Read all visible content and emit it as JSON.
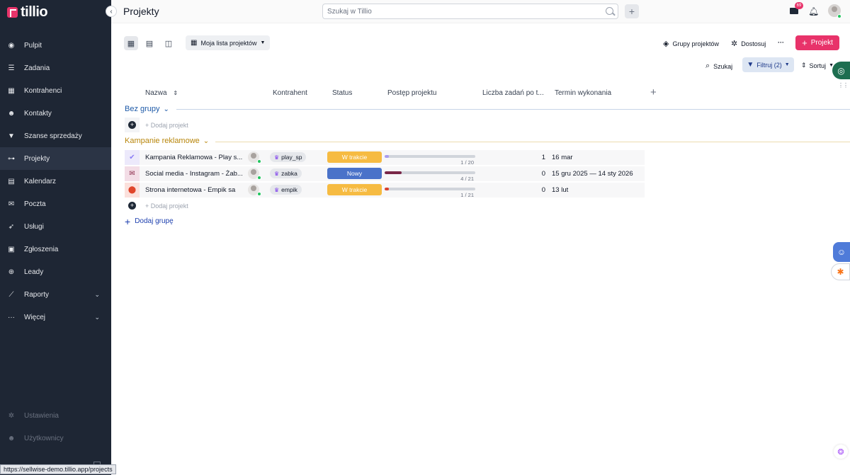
{
  "sidebar": {
    "logo": "tillio",
    "items": [
      {
        "label": "Pulpit",
        "icon": "gauge-icon"
      },
      {
        "label": "Zadania",
        "icon": "tasks-icon"
      },
      {
        "label": "Kontrahenci",
        "icon": "building-icon"
      },
      {
        "label": "Kontakty",
        "icon": "people-icon"
      },
      {
        "label": "Szanse sprzedaży",
        "icon": "funnel-icon"
      },
      {
        "label": "Projekty",
        "icon": "sitemap-icon"
      },
      {
        "label": "Kalendarz",
        "icon": "calendar-icon"
      },
      {
        "label": "Poczta",
        "icon": "mail-icon"
      },
      {
        "label": "Usługi",
        "icon": "rocket-icon"
      },
      {
        "label": "Zgłoszenia",
        "icon": "clipboard-icon"
      },
      {
        "label": "Leady",
        "icon": "crosshair-icon"
      },
      {
        "label": "Raporty",
        "icon": "chart-icon"
      },
      {
        "label": "Więcej",
        "icon": "dots-icon"
      }
    ],
    "active": "Projekty",
    "bottom_items": [
      {
        "label": "Ustawienia",
        "icon": "gear-icon"
      },
      {
        "label": "Użytkownicy",
        "icon": "users-icon"
      }
    ],
    "status_url": "https://sellwise-demo.tillio.app/projects"
  },
  "header": {
    "title": "Projekty",
    "search_placeholder": "Szukaj w Tillio",
    "mail_badge": "69"
  },
  "toolbar": {
    "list_label": "Moja lista projektów",
    "groups_label": "Grupy projektów",
    "customize_label": "Dostosuj",
    "more_label": "···",
    "new_project_label": "Projekt",
    "search_label": "Szukaj",
    "filter_label": "Filtruj (2)",
    "sort_label": "Sortuj"
  },
  "table": {
    "columns": [
      "Nazwa",
      "Kontrahent",
      "Status",
      "Postęp projektu",
      "Liczba zadań po t...",
      "Termin wykonania"
    ],
    "add_project_label": "+ Dodaj projekt",
    "add_group_label": "Dodaj grupę",
    "groups": [
      {
        "name": "Bez grupy",
        "color": "#1e5aa8",
        "rows": []
      },
      {
        "name": "Kampanie reklamowe",
        "color": "#b8860b",
        "rows": [
          {
            "name": "Kampania Reklamowa - Play s...",
            "icon": "badge-check-icon",
            "icon_color": "#8b7cf6",
            "icon_bg": "#ece9fb",
            "client": "play_sp",
            "status": "W trakcie",
            "status_color": "#f6bb42",
            "progress": 0.05,
            "progress_color": "#a99cf0",
            "progress_label": "1 / 20",
            "tasks": "1",
            "deadline": "16 mar"
          },
          {
            "name": "Social media - Instagram - Żab...",
            "icon": "envelope-icon",
            "icon_color": "#8b2a4a",
            "icon_bg": "#f3dde6",
            "client": "zabka",
            "status": "Nowy",
            "status_color": "#4a72c9",
            "progress": 0.19,
            "progress_color": "#7a2748",
            "progress_label": "4 / 21",
            "tasks": "0",
            "deadline": "15 gru 2025 — 14 sty 2026"
          },
          {
            "name": "Strona internetowa - Empik sa",
            "icon": "map-pin-icon",
            "icon_color": "#e0452b",
            "icon_bg": "#fbe0dc",
            "client": "empik",
            "status": "W trakcie",
            "status_color": "#f6bb42",
            "progress": 0.05,
            "progress_color": "#d9412c",
            "progress_label": "1 / 21",
            "tasks": "0",
            "deadline": "13 lut"
          }
        ]
      }
    ]
  }
}
